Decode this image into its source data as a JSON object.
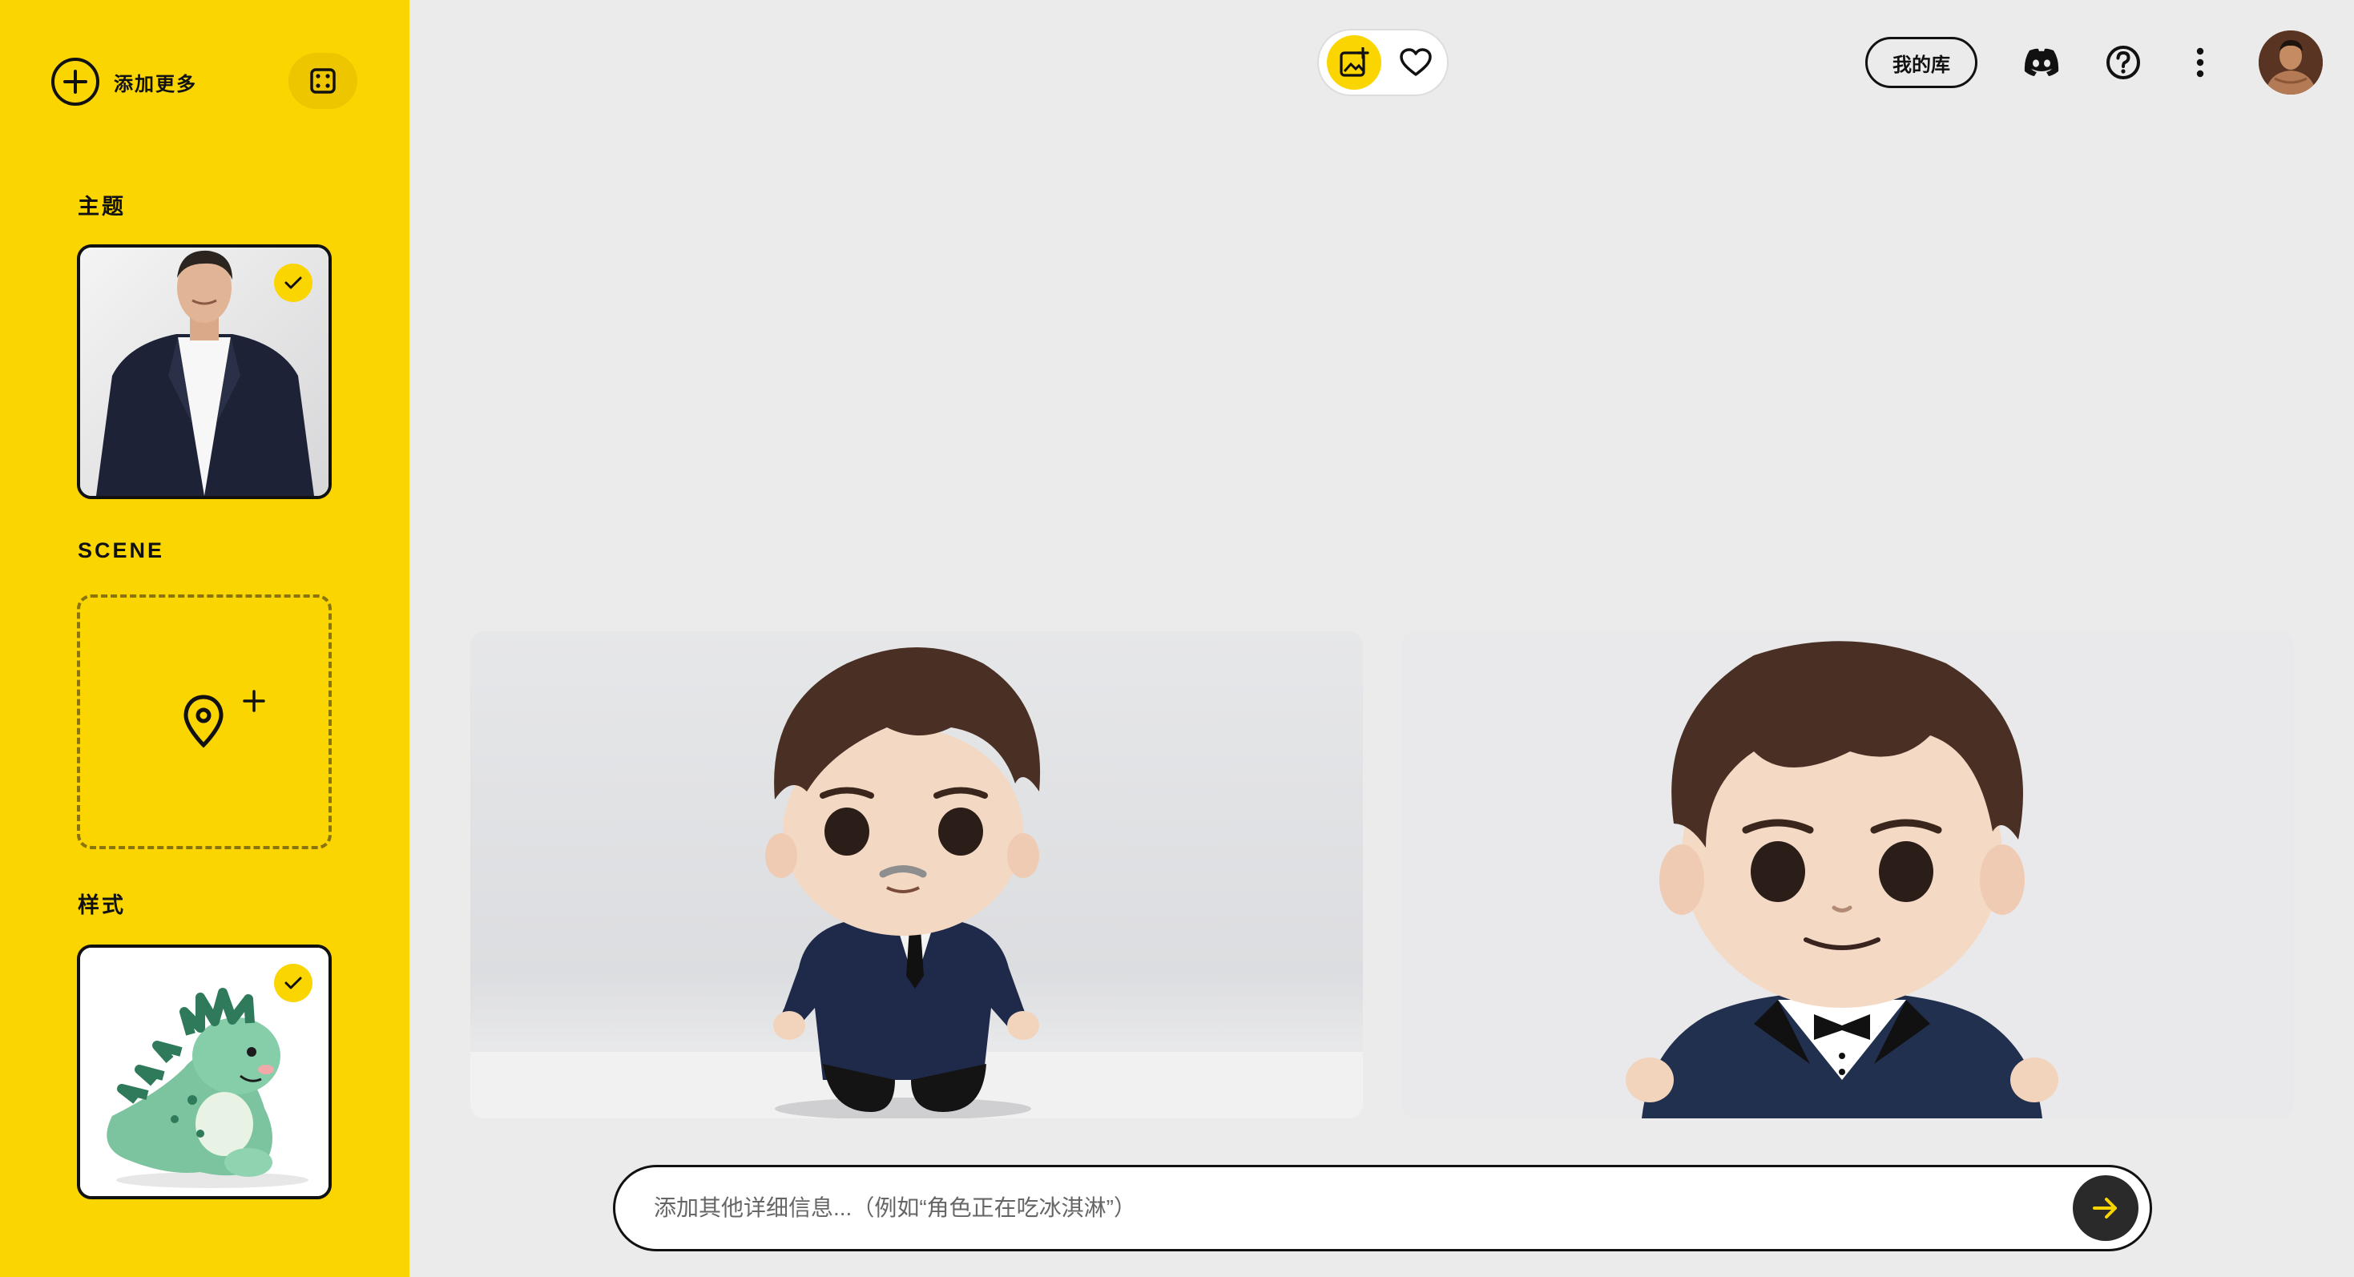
{
  "sidebar": {
    "add_more_label": "添加更多",
    "subject_title": "主题",
    "scene_title": "SCENE",
    "style_title": "样式"
  },
  "topbar": {
    "library_label": "我的库"
  },
  "prompt": {
    "placeholder": "添加其他详细信息...（例如“角色正在吃冰淇淋”）"
  },
  "colors": {
    "brand_yellow": "#fbd500",
    "background": "#ebebeb"
  },
  "icons": [
    "plus-circle-icon",
    "dice-icon",
    "check-icon",
    "location-pin-icon",
    "plus-icon",
    "image-add-icon",
    "heart-icon",
    "discord-icon",
    "help-icon",
    "more-vertical-icon",
    "arrow-right-icon"
  ]
}
